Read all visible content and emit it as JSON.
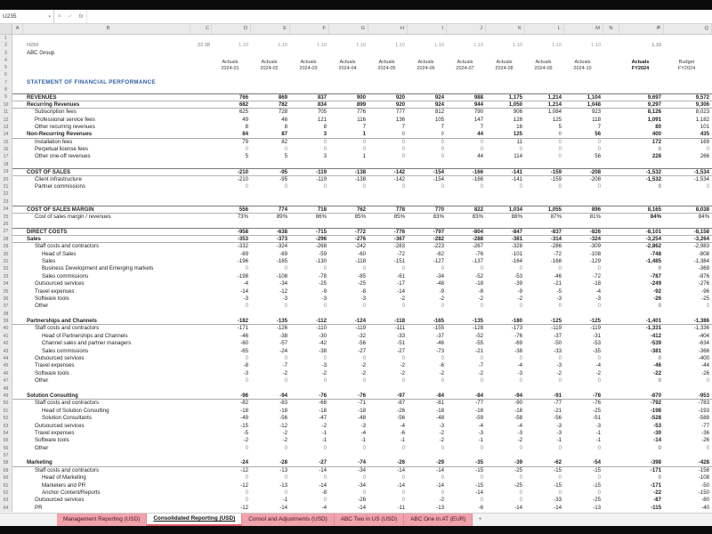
{
  "name_box": {
    "value": "U235"
  },
  "formula_bar": {
    "cancel": "✕",
    "enter": "✓",
    "fx_label": "fx",
    "chevron": "▾"
  },
  "colors": {
    "tab_pink": "#f0a3ac",
    "title_blue": "#2e5fa3",
    "code_red": "#c00000"
  },
  "grid": {
    "col_letters": [
      "A",
      "B",
      "C",
      "D",
      "E",
      "F",
      "G",
      "H",
      "I",
      "J",
      "K",
      "L",
      "M",
      "N",
      "P",
      "Q"
    ]
  },
  "sheet": {
    "rows": [
      {
        "n": 1,
        "t": "blank"
      },
      {
        "n": 2,
        "t": "meta",
        "b": "H250",
        "c": "22.38",
        "v": [
          "1.10",
          "1.10",
          "1.10",
          "1.10",
          "1.10",
          "1.10",
          "1.10",
          "1.10",
          "1.10",
          "1.10",
          "1.10",
          ""
        ]
      },
      {
        "n": 3,
        "t": "company",
        "b": "ABC Group"
      },
      {
        "n": 4,
        "t": "monthhead",
        "heads": [
          [
            "Actuals",
            "2024-01"
          ],
          [
            "Actuals",
            "2024-02"
          ],
          [
            "Actuals",
            "2024-03"
          ],
          [
            "Actuals",
            "2024-04"
          ],
          [
            "Actuals",
            "2024-05"
          ],
          [
            "Actuals",
            "2024-06"
          ],
          [
            "Actuals",
            "2024-07"
          ],
          [
            "Actuals",
            "2024-08"
          ],
          [
            "Actuals",
            "2024-09"
          ],
          [
            "Actuals",
            "2024-10"
          ],
          [
            "Actuals",
            "FY2024"
          ],
          [
            "Budget",
            "FY2024"
          ]
        ]
      },
      {
        "n": 6,
        "t": "blank"
      },
      {
        "n": 7,
        "t": "title",
        "b": "STATEMENT OF FINANCIAL PERFORMANCE"
      },
      {
        "n": 8,
        "t": "blank"
      },
      {
        "n": 9,
        "t": "data",
        "cls": "section",
        "b": "REVENUES",
        "v": [
          "766",
          "869",
          "837",
          "900",
          "920",
          "924",
          "988",
          "1,175",
          "1,214",
          "1,104",
          "9,697",
          "9,572"
        ]
      },
      {
        "n": 10,
        "t": "data",
        "cls": "subsection",
        "b": "Recurring Revenues",
        "v": [
          "682",
          "782",
          "834",
          "899",
          "920",
          "924",
          "944",
          "1,050",
          "1,214",
          "1,048",
          "9,297",
          "9,306"
        ]
      },
      {
        "n": 11,
        "t": "data",
        "cls": "item",
        "b": "Subscription fees",
        "v": [
          "625",
          "728",
          "705",
          "776",
          "777",
          "812",
          "790",
          "906",
          "1,084",
          "923",
          "8,126",
          "8,023"
        ]
      },
      {
        "n": 12,
        "t": "data",
        "cls": "item",
        "b": "Professional service fees",
        "v": [
          "49",
          "46",
          "121",
          "116",
          "136",
          "105",
          "147",
          "128",
          "125",
          "118",
          "1,091",
          "1,182"
        ]
      },
      {
        "n": 13,
        "t": "data",
        "cls": "item",
        "b": "Other recurring revenues",
        "v": [
          "8",
          "8",
          "8",
          "7",
          "7",
          "7",
          "7",
          "16",
          "5",
          "7",
          "80",
          "101"
        ]
      },
      {
        "n": 14,
        "t": "data",
        "cls": "subsection",
        "b": "Non-Recurring Revenues",
        "v": [
          "84",
          "87",
          "3",
          "1",
          "0",
          "0",
          "44",
          "125",
          "0",
          "56",
          "400",
          "435"
        ]
      },
      {
        "n": 15,
        "t": "data",
        "cls": "item",
        "b": "Installation fees",
        "v": [
          "79",
          "82",
          "0",
          "0",
          "0",
          "0",
          "0",
          "11",
          "0",
          "0",
          "172",
          "169"
        ]
      },
      {
        "n": 16,
        "t": "data",
        "cls": "item",
        "b": "Perpetual license fees",
        "v": [
          "0",
          "0",
          "0",
          "0",
          "0",
          "0",
          "0",
          "0",
          "0",
          "0",
          "0",
          "0"
        ]
      },
      {
        "n": 17,
        "t": "data",
        "cls": "item",
        "b": "Other one-off revenues",
        "v": [
          "5",
          "5",
          "3",
          "1",
          "0",
          "0",
          "44",
          "114",
          "0",
          "56",
          "228",
          "266"
        ]
      },
      {
        "n": 18,
        "t": "blank"
      },
      {
        "n": 19,
        "t": "data",
        "cls": "section",
        "b": "COST OF SALES",
        "v": [
          "-210",
          "-95",
          "-119",
          "-138",
          "-142",
          "-154",
          "-166",
          "-141",
          "-159",
          "-208",
          "-1,532",
          "-1,534"
        ]
      },
      {
        "n": 20,
        "t": "data",
        "cls": "item",
        "b": "Client infrastructure",
        "v": [
          "-210",
          "-95",
          "-119",
          "-138",
          "-142",
          "-154",
          "-166",
          "-141",
          "-159",
          "-208",
          "-1,532",
          "-1,534"
        ]
      },
      {
        "n": 21,
        "t": "data",
        "cls": "item",
        "b": "Partner commissions",
        "v": [
          "0",
          "0",
          "0",
          "0",
          "0",
          "0",
          "0",
          "0",
          "0",
          "0",
          "0",
          "0"
        ]
      },
      {
        "n": 22,
        "t": "blank"
      },
      {
        "n": 23,
        "t": "blank"
      },
      {
        "n": 24,
        "t": "data",
        "cls": "section",
        "b": "COST OF SALES MARGIN",
        "v": [
          "556",
          "774",
          "718",
          "762",
          "778",
          "770",
          "822",
          "1,034",
          "1,055",
          "896",
          "8,165",
          "8,038"
        ]
      },
      {
        "n": 25,
        "t": "data",
        "cls": "item",
        "b": "Cost of sales margin / revenues",
        "v": [
          "73%",
          "89%",
          "86%",
          "85%",
          "85%",
          "83%",
          "83%",
          "88%",
          "87%",
          "81%",
          "84%",
          "84%"
        ]
      },
      {
        "n": 26,
        "t": "blank"
      },
      {
        "n": 27,
        "t": "data",
        "cls": "section",
        "b": "DIRECT COSTS",
        "v": [
          "-958",
          "-638",
          "-715",
          "-772",
          "-776",
          "-797",
          "-804",
          "-847",
          "-837",
          "-826",
          "-8,101",
          "-8,158"
        ]
      },
      {
        "n": 28,
        "t": "data",
        "cls": "subsection",
        "b": "Sales",
        "v": [
          "-353",
          "-373",
          "-296",
          "-276",
          "-367",
          "-282",
          "-288",
          "-381",
          "-314",
          "-324",
          "-3,254",
          "-3,264"
        ]
      },
      {
        "n": 29,
        "t": "data",
        "cls": "item",
        "b": "Staff costs and contractors",
        "v": [
          "-332",
          "-324",
          "-268",
          "-242",
          "-283",
          "-223",
          "-267",
          "-328",
          "-286",
          "-309",
          "-2,862",
          "-2,983"
        ]
      },
      {
        "n": 30,
        "t": "data",
        "cls": "sub2",
        "b": "Head of Sales",
        "v": [
          "-69",
          "-69",
          "-59",
          "-60",
          "-72",
          "-62",
          "-76",
          "-101",
          "-72",
          "-108",
          "-748",
          "-808"
        ]
      },
      {
        "n": 31,
        "t": "data",
        "cls": "sub2",
        "b": "Sales",
        "v": [
          "-196",
          "-165",
          "-130",
          "-118",
          "-151",
          "-127",
          "-137",
          "-164",
          "-168",
          "-129",
          "-1,485",
          "-1,384"
        ]
      },
      {
        "n": 32,
        "t": "data",
        "cls": "sub2",
        "b": "Business Development and Emerging markets",
        "v": [
          "0",
          "0",
          "0",
          "0",
          "0",
          "0",
          "0",
          "0",
          "0",
          "0",
          "0",
          "-369"
        ]
      },
      {
        "n": 33,
        "t": "data",
        "cls": "sub2",
        "b": "Sales commissions",
        "v": [
          "-198",
          "-108",
          "-78",
          "-85",
          "-61",
          "-34",
          "-52",
          "-53",
          "-46",
          "-72",
          "-787",
          "-876"
        ]
      },
      {
        "n": 34,
        "t": "data",
        "cls": "item",
        "b": "Outsourced services",
        "v": [
          "-4",
          "-34",
          "-25",
          "-25",
          "-17",
          "-48",
          "-18",
          "-39",
          "-21",
          "-18",
          "-249",
          "-276"
        ]
      },
      {
        "n": 35,
        "t": "data",
        "cls": "item",
        "b": "Travel expenses",
        "v": [
          "-14",
          "-12",
          "-9",
          "-8",
          "-14",
          "-9",
          "-8",
          "-9",
          "-5",
          "-4",
          "-92",
          "-96"
        ]
      },
      {
        "n": 36,
        "t": "data",
        "cls": "item",
        "b": "Software tools",
        "v": [
          "-3",
          "-3",
          "-3",
          "-3",
          "-2",
          "-2",
          "-2",
          "-2",
          "-3",
          "-3",
          "-26",
          "-25"
        ]
      },
      {
        "n": 37,
        "t": "data",
        "cls": "item",
        "b": "Other",
        "v": [
          "0",
          "0",
          "0",
          "0",
          "0",
          "0",
          "0",
          "0",
          "0",
          "0",
          "0",
          "0"
        ]
      },
      {
        "n": 38,
        "t": "blank"
      },
      {
        "n": 39,
        "t": "data",
        "cls": "subsection",
        "b": "Partnerships and Channels",
        "v": [
          "-182",
          "-135",
          "-112",
          "-124",
          "-118",
          "-165",
          "-135",
          "-180",
          "-125",
          "-125",
          "-1,401",
          "-1,386"
        ]
      },
      {
        "n": 40,
        "t": "data",
        "cls": "item",
        "b": "Staff costs and contractors",
        "v": [
          "-171",
          "-126",
          "-110",
          "-119",
          "-111",
          "-155",
          "-128",
          "-173",
          "-119",
          "-119",
          "-1,331",
          "-1,336"
        ]
      },
      {
        "n": 41,
        "t": "data",
        "cls": "sub2",
        "b": "Head of Partnerships and Channels",
        "v": [
          "-46",
          "-38",
          "-30",
          "-32",
          "-33",
          "-37",
          "-52",
          "-76",
          "-37",
          "-31",
          "-412",
          "-404"
        ]
      },
      {
        "n": 42,
        "t": "data",
        "cls": "sub2",
        "b": "Channel sales and partner managers",
        "v": [
          "-60",
          "-57",
          "-42",
          "-56",
          "-51",
          "-46",
          "-55",
          "-69",
          "-50",
          "-53",
          "-539",
          "-634"
        ]
      },
      {
        "n": 43,
        "t": "data",
        "cls": "sub2",
        "b": "Sales commissions",
        "v": [
          "-65",
          "-24",
          "-38",
          "-27",
          "-27",
          "-73",
          "-21",
          "-38",
          "-33",
          "-35",
          "-381",
          "-366"
        ]
      },
      {
        "n": 44,
        "t": "data",
        "cls": "item",
        "b": "Outsourced services",
        "v": [
          "0",
          "0",
          "0",
          "0",
          "0",
          "0",
          "0",
          "0",
          "0",
          "0",
          "0",
          "-400"
        ]
      },
      {
        "n": 45,
        "t": "data",
        "cls": "item",
        "b": "Travel expenses",
        "v": [
          "-8",
          "-7",
          "-3",
          "-2",
          "-2",
          "-6",
          "-7",
          "-4",
          "-3",
          "-4",
          "-46",
          "-44"
        ]
      },
      {
        "n": 46,
        "t": "data",
        "cls": "item",
        "b": "Software tools",
        "v": [
          "-3",
          "-2",
          "-2",
          "-2",
          "-2",
          "-2",
          "-2",
          "-3",
          "-2",
          "-2",
          "-22",
          "-26"
        ]
      },
      {
        "n": 47,
        "t": "data",
        "cls": "item",
        "b": "Other",
        "v": [
          "0",
          "0",
          "0",
          "0",
          "0",
          "0",
          "0",
          "0",
          "0",
          "0",
          "0",
          "0"
        ]
      },
      {
        "n": 48,
        "t": "blank"
      },
      {
        "n": 49,
        "t": "data",
        "cls": "subsection",
        "b": "Solution Consulting",
        "v": [
          "-96",
          "-94",
          "-76",
          "-76",
          "-97",
          "-84",
          "-84",
          "-94",
          "-91",
          "-78",
          "-870",
          "-953"
        ]
      },
      {
        "n": 50,
        "t": "data",
        "cls": "item",
        "b": "Staff costs and contractors",
        "v": [
          "-82",
          "-83",
          "-68",
          "-71",
          "-87",
          "-81",
          "-77",
          "-90",
          "-77",
          "-76",
          "-792",
          "-783"
        ]
      },
      {
        "n": 51,
        "t": "data",
        "cls": "sub2",
        "b": "Head of Solution Consulting",
        "v": [
          "-18",
          "-18",
          "-18",
          "-18",
          "-26",
          "-18",
          "-18",
          "-18",
          "-21",
          "-25",
          "-198",
          "-193"
        ]
      },
      {
        "n": 52,
        "t": "data",
        "cls": "sub2",
        "b": "Solution Consultants",
        "v": [
          "-49",
          "-56",
          "-47",
          "-48",
          "-56",
          "-48",
          "-59",
          "-58",
          "-56",
          "-51",
          "-528",
          "-588"
        ]
      },
      {
        "n": 53,
        "t": "data",
        "cls": "item",
        "b": "Outsourced services",
        "v": [
          "-15",
          "-12",
          "-2",
          "-3",
          "-4",
          "-3",
          "-4",
          "-4",
          "-3",
          "-3",
          "-53",
          "-77"
        ]
      },
      {
        "n": 54,
        "t": "data",
        "cls": "item",
        "b": "Travel expenses",
        "v": [
          "-5",
          "-2",
          "-1",
          "-4",
          "-6",
          "-2",
          "-3",
          "-3",
          "-3",
          "-1",
          "-30",
          "-36"
        ]
      },
      {
        "n": 55,
        "t": "data",
        "cls": "item",
        "b": "Software tools",
        "v": [
          "-2",
          "-2",
          "-1",
          "-1",
          "-1",
          "-2",
          "-1",
          "-2",
          "-1",
          "-1",
          "-14",
          "-26"
        ]
      },
      {
        "n": 56,
        "t": "data",
        "cls": "item",
        "b": "Other",
        "v": [
          "0",
          "0",
          "0",
          "0",
          "0",
          "0",
          "0",
          "0",
          "0",
          "0",
          "0",
          "0"
        ]
      },
      {
        "n": 57,
        "t": "blank"
      },
      {
        "n": 58,
        "t": "data",
        "cls": "subsection",
        "b": "Marketing",
        "v": [
          "-24",
          "-28",
          "-27",
          "-74",
          "-26",
          "-29",
          "-35",
          "-39",
          "-62",
          "-54",
          "-398",
          "-428"
        ]
      },
      {
        "n": 59,
        "t": "data",
        "cls": "item",
        "b": "Staff costs and contractors",
        "v": [
          "-12",
          "-13",
          "-14",
          "-34",
          "-14",
          "-14",
          "-15",
          "-25",
          "-15",
          "-15",
          "-171",
          "-158"
        ]
      },
      {
        "n": 60,
        "t": "data",
        "cls": "sub2",
        "b": "Head of Marketing",
        "v": [
          "0",
          "0",
          "0",
          "0",
          "0",
          "0",
          "0",
          "0",
          "0",
          "0",
          "0",
          "-108"
        ]
      },
      {
        "n": 61,
        "t": "data",
        "cls": "sub2",
        "b": "Marketers and PR",
        "v": [
          "-12",
          "-13",
          "-14",
          "-34",
          "-14",
          "-14",
          "-15",
          "-25",
          "-15",
          "-15",
          "-171",
          "-50"
        ]
      },
      {
        "n": 62,
        "t": "data",
        "cls": "sub2",
        "b": "Anchor Content/Reports",
        "v": [
          "0",
          "0",
          "-8",
          "0",
          "0",
          "0",
          "-14",
          "0",
          "0",
          "0",
          "-22",
          "-150"
        ]
      },
      {
        "n": 63,
        "t": "data",
        "cls": "item",
        "b": "Outsourced services",
        "v": [
          "0",
          "-1",
          "0",
          "-26",
          "0",
          "-2",
          "0",
          "0",
          "-33",
          "-25",
          "-87",
          "-80"
        ]
      },
      {
        "n": 64,
        "t": "data",
        "cls": "item",
        "b": "PR",
        "v": [
          "-12",
          "-14",
          "-4",
          "-14",
          "-11",
          "-13",
          "-6",
          "-14",
          "-14",
          "-13",
          "-115",
          "-40"
        ]
      }
    ]
  },
  "tabs": {
    "items": [
      {
        "label": "Management Reporting (USD)",
        "active": false
      },
      {
        "label": "Consolidated Reporting (USD)",
        "active": true
      },
      {
        "label": "Consol and Adjustments (USD)",
        "active": false
      },
      {
        "label": "ABC Two in US (USD)",
        "active": false
      },
      {
        "label": "ABC One in AT (EUR)",
        "active": false
      }
    ],
    "add_label": "+"
  }
}
